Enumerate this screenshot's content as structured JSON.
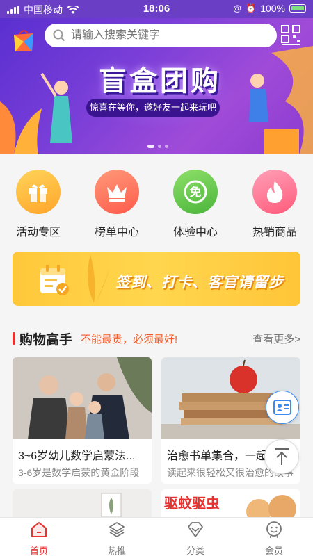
{
  "status_bar": {
    "carrier": "中国移动",
    "time": "18:06",
    "battery": "100%"
  },
  "search": {
    "placeholder": "请输入搜索关键字"
  },
  "banner": {
    "title": "盲盒团购",
    "subtitle": "惊喜在等你，邀好友一起来玩吧"
  },
  "categories": [
    {
      "label": "活动专区",
      "icon": "gift-icon",
      "color": "#ffb52e"
    },
    {
      "label": "榜单中心",
      "icon": "crown-icon",
      "color": "#ff7a6a"
    },
    {
      "label": "体验中心",
      "icon": "free-badge-icon",
      "color": "#6ccf4a"
    },
    {
      "label": "热销商品",
      "icon": "flame-icon",
      "color": "#ff7a9a"
    }
  ],
  "signin_banner": {
    "text": "签到、打卡、客官请留步"
  },
  "section": {
    "title": "购物高手",
    "slogan": "不能最贵，必须最好!",
    "more": "查看更多>"
  },
  "products": [
    {
      "title": "3~6岁幼儿数学启蒙法...",
      "subtitle": "3-6岁是数学启蒙的黄金阶段"
    },
    {
      "title": "治愈书单集合，一起来",
      "subtitle": "读起来很轻松又很治愈的故事"
    },
    {
      "title": "",
      "subtitle": ""
    },
    {
      "title": "驱蚊驱虫",
      "subtitle": ""
    }
  ],
  "tabs": [
    {
      "label": "首页",
      "icon": "home-icon",
      "active": true
    },
    {
      "label": "热推",
      "icon": "layers-icon",
      "active": false
    },
    {
      "label": "分类",
      "icon": "diamond-icon",
      "active": false
    },
    {
      "label": "会员",
      "icon": "member-icon",
      "active": false
    }
  ],
  "colors": {
    "accent": "#e8322f",
    "banner": "#6a3fc5",
    "signin": "#ffc83a"
  }
}
